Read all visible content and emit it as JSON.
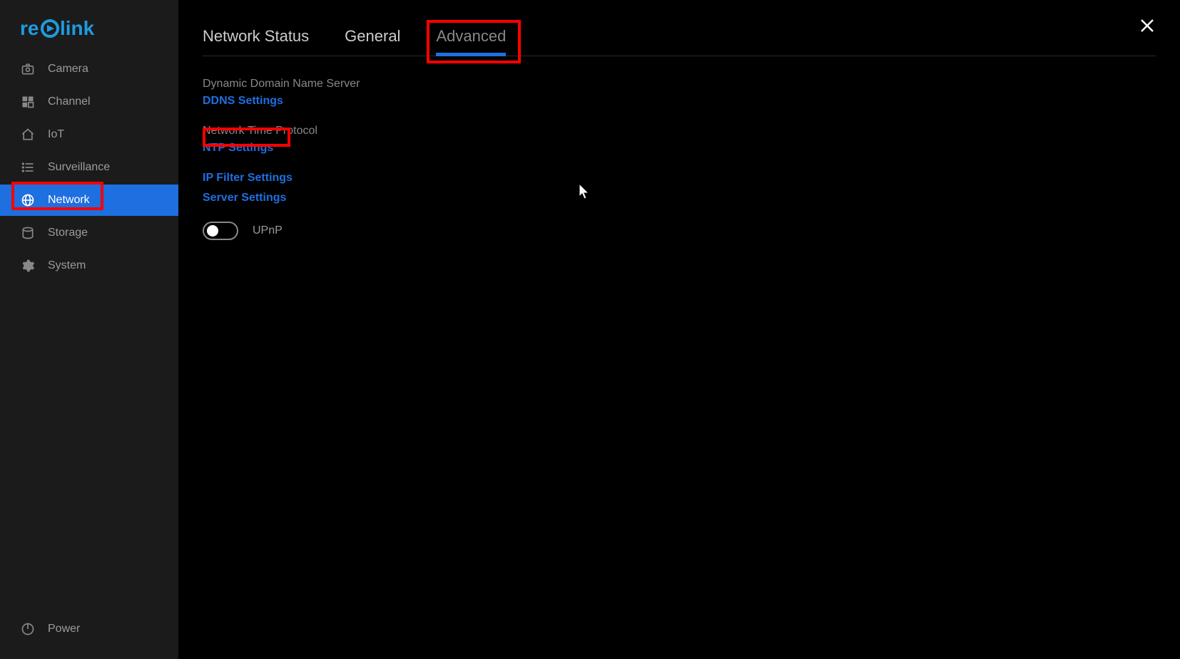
{
  "brand": "reolink",
  "sidebar": {
    "items": [
      {
        "label": "Camera",
        "icon": "camera"
      },
      {
        "label": "Channel",
        "icon": "grid"
      },
      {
        "label": "IoT",
        "icon": "home"
      },
      {
        "label": "Surveillance",
        "icon": "list"
      },
      {
        "label": "Network",
        "icon": "globe",
        "active": true
      },
      {
        "label": "Storage",
        "icon": "disk"
      },
      {
        "label": "System",
        "icon": "gear"
      }
    ],
    "power_label": "Power"
  },
  "tabs": [
    {
      "label": "Network Status"
    },
    {
      "label": "General"
    },
    {
      "label": "Advanced",
      "active": true
    }
  ],
  "advanced": {
    "ddns_heading": "Dynamic Domain Name Server",
    "ddns_link": "DDNS Settings",
    "ntp_heading": "Network Time Protocol",
    "ntp_link": "NTP Settings",
    "ip_filter_link": "IP Filter Settings",
    "server_settings_link": "Server Settings",
    "upnp_label": "UPnP",
    "upnp_on": false
  }
}
